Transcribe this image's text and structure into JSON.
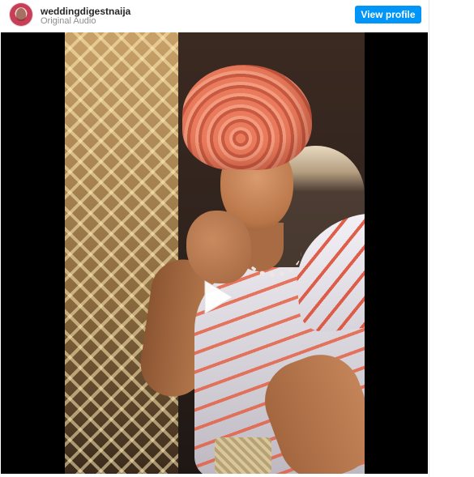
{
  "post_header": {
    "username": "weddingdigestnaija",
    "audio_label": "Original Audio",
    "view_profile_label": "View profile"
  },
  "colors": {
    "accent": "#0095f6",
    "media_background": "#000000",
    "username_text": "#262626",
    "secondary_text": "#8e8e8e"
  },
  "media": {
    "type": "video",
    "overlay_icon": "play-icon"
  }
}
